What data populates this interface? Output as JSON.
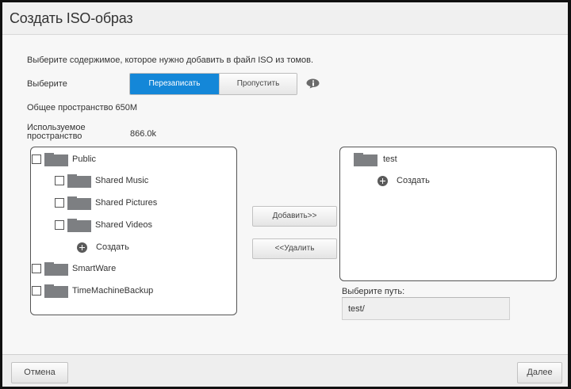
{
  "dialog": {
    "title": "Создать ISO-образ"
  },
  "body": {
    "instruction": "Выберите содержимое, которое нужно добавить в файл ISO из томов.",
    "select_label": "Выберите",
    "overwrite_label": "Перезаписать",
    "skip_label": "Пропустить",
    "selected_option": "Перезаписать",
    "total_space": "Общее пространство 650M",
    "used_space_label_line1": "Используемое",
    "used_space_label_line2": "пространство",
    "used_space_value": "866.0k"
  },
  "source_tree": {
    "items": [
      {
        "label": "Public",
        "level": 0,
        "checked": false
      },
      {
        "label": "Shared Music",
        "level": 1,
        "checked": false
      },
      {
        "label": "Shared Pictures",
        "level": 1,
        "checked": false
      },
      {
        "label": "Shared Videos",
        "level": 1,
        "checked": false
      },
      {
        "label": "SmartWare",
        "level": 0,
        "checked": false
      },
      {
        "label": "TimeMachineBackup",
        "level": 0,
        "checked": false
      }
    ],
    "create_label": "Создать"
  },
  "actions": {
    "add_label": "Добавить>>",
    "remove_label": "<<Удалить"
  },
  "target_tree": {
    "root_label": "test",
    "create_label": "Создать"
  },
  "path": {
    "label": "Выберите путь:",
    "value": "test/"
  },
  "footer": {
    "cancel_label": "Отмена",
    "next_label": "Далее"
  },
  "colors": {
    "accent": "#1487d8",
    "folder_icon": "#7d7f82"
  }
}
